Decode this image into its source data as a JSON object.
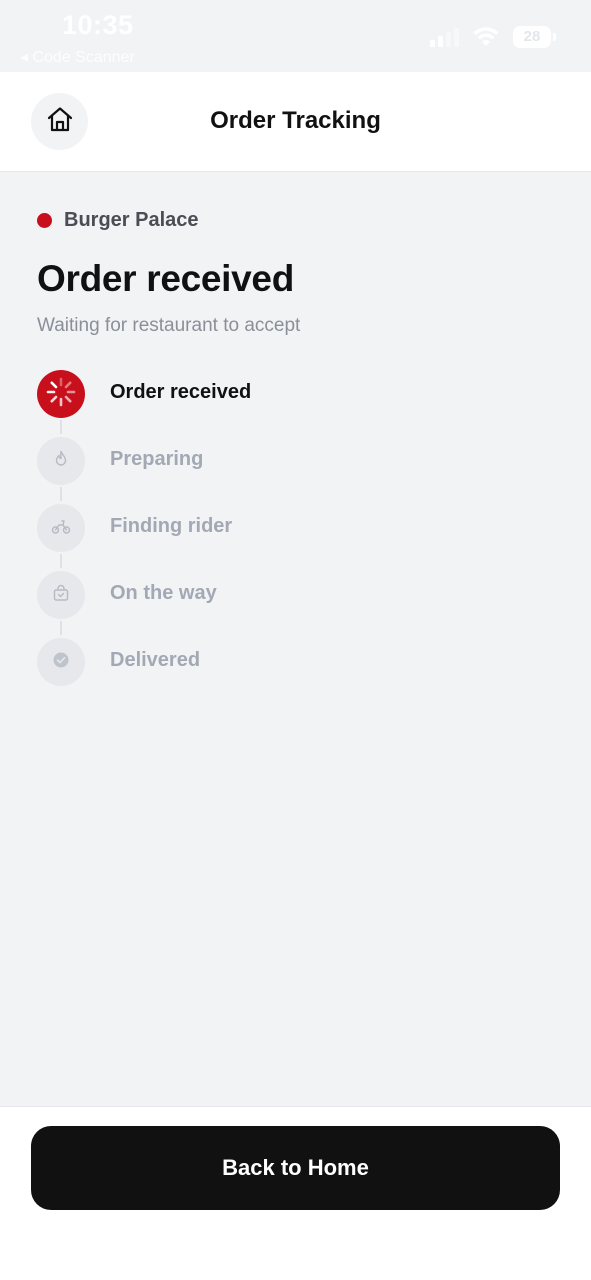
{
  "status_bar": {
    "time": "10:35",
    "back_label": "◂ Code Scanner",
    "battery": "28"
  },
  "header": {
    "title": "Order Tracking",
    "home_icon": "home-icon"
  },
  "restaurant": {
    "name": "Burger Palace",
    "status_dot_color": "#c8101c"
  },
  "order": {
    "status_title": "Order received",
    "status_subtitle": "Waiting for restaurant to accept"
  },
  "steps": [
    {
      "label": "Order received",
      "icon": "spinner-icon",
      "active": true
    },
    {
      "label": "Preparing",
      "icon": "flame-icon",
      "active": false
    },
    {
      "label": "Finding rider",
      "icon": "bike-icon",
      "active": false
    },
    {
      "label": "On the way",
      "icon": "bag-icon",
      "active": false
    },
    {
      "label": "Delivered",
      "icon": "check-circle-icon",
      "active": false
    }
  ],
  "footer": {
    "back_home_label": "Back to Home"
  },
  "colors": {
    "accent": "#c8101c",
    "background": "#f2f3f5",
    "button": "#111111",
    "inactive_text": "#a3a9b4"
  }
}
